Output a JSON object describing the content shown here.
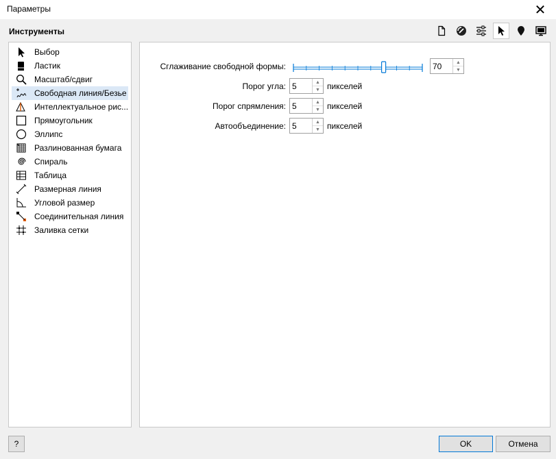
{
  "window": {
    "title": "Параметры",
    "close_symbol": "✕"
  },
  "section_title": "Инструменты",
  "toolbar": [
    {
      "name": "document-icon",
      "active": false
    },
    {
      "name": "color-management-icon",
      "active": false
    },
    {
      "name": "customization-icon",
      "active": false
    },
    {
      "name": "tools-pointer-icon",
      "active": true
    },
    {
      "name": "global-pin-icon",
      "active": false
    },
    {
      "name": "display-icon",
      "active": false
    }
  ],
  "tools": [
    {
      "label": "Выбор",
      "icon": "pick-arrow-icon",
      "selected": false
    },
    {
      "label": "Ластик",
      "icon": "eraser-icon",
      "selected": false
    },
    {
      "label": "Масштаб/сдвиг",
      "icon": "zoom-icon",
      "selected": false
    },
    {
      "label": "Свободная линия/Безье",
      "icon": "freehand-icon",
      "selected": true
    },
    {
      "label": "Интеллектуальное рис...",
      "icon": "smart-drawing-icon",
      "selected": false
    },
    {
      "label": "Прямоугольник",
      "icon": "rectangle-icon",
      "selected": false
    },
    {
      "label": "Эллипс",
      "icon": "ellipse-icon",
      "selected": false
    },
    {
      "label": "Разлинованная бумага",
      "icon": "graph-paper-icon",
      "selected": false
    },
    {
      "label": "Спираль",
      "icon": "spiral-icon",
      "selected": false
    },
    {
      "label": "Таблица",
      "icon": "table-icon",
      "selected": false
    },
    {
      "label": "Размерная линия",
      "icon": "dimension-line-icon",
      "selected": false
    },
    {
      "label": "Угловой размер",
      "icon": "angular-dimension-icon",
      "selected": false
    },
    {
      "label": "Соединительная линия",
      "icon": "connector-icon",
      "selected": false
    },
    {
      "label": "Заливка сетки",
      "icon": "mesh-fill-icon",
      "selected": false
    }
  ],
  "settings": {
    "smoothing": {
      "label": "Сглаживание свободной формы:",
      "value": "70",
      "min": 0,
      "max": 100
    },
    "corner": {
      "label": "Порог угла:",
      "value": "5",
      "unit": "пикселей"
    },
    "straight": {
      "label": "Порог спрямления:",
      "value": "5",
      "unit": "пикселей"
    },
    "autojoin": {
      "label": "Автообъединение:",
      "value": "5",
      "unit": "пикселей"
    }
  },
  "buttons": {
    "help": "?",
    "ok": "OK",
    "cancel": "Отмена"
  },
  "colors": {
    "selection": "#dbe8f6",
    "slider_accent": "#0078d7"
  }
}
